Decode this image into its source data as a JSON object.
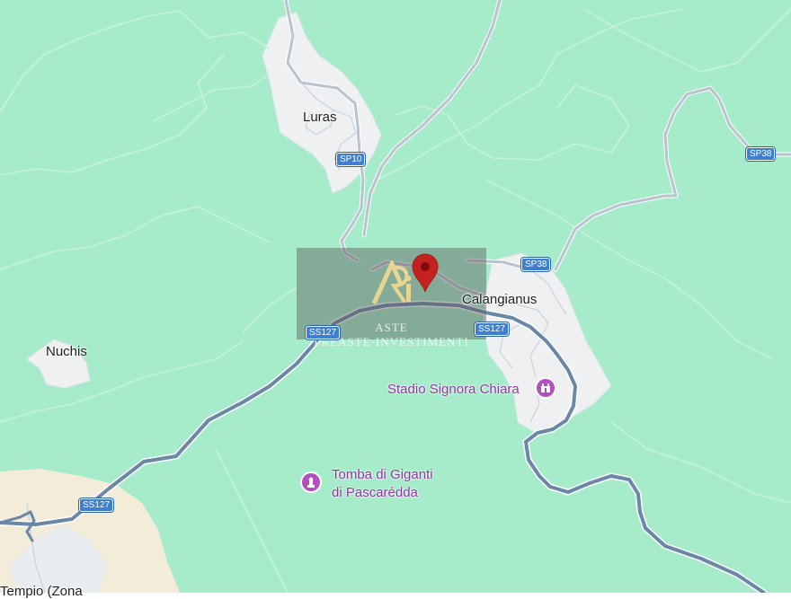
{
  "towns": {
    "luras": "Luras",
    "calangianus": "Calangianus",
    "nuchis": "Nuchis",
    "tempio": "Tempio (Zona"
  },
  "roads": {
    "sp10": "SP10",
    "sp38_top": "SP38",
    "sp38": "SP38",
    "ss127_a": "SS127",
    "ss127_b": "SS127",
    "ss127_c": "SS127"
  },
  "pois": {
    "stadio": "Stadio Signora Chiara",
    "tomba_line1": "Tomba di Giganti",
    "tomba_line2": "di Pascarédda"
  },
  "watermark": {
    "text": "ASTE PREASTE·INVESTIMENTI"
  },
  "icons": {
    "location_pin": "map-pin-icon",
    "stadium": "stadium-icon",
    "monument": "monument-icon",
    "logo": "ri-logo-icon"
  },
  "colors": {
    "land": "#a6ebca",
    "urban": "#eef0f2",
    "urban_tempio": "#f2ecd9",
    "road": "#8ea3bd",
    "road_main": "#6a87a8",
    "pin": "#c5221f",
    "poi": "#9334a5"
  }
}
